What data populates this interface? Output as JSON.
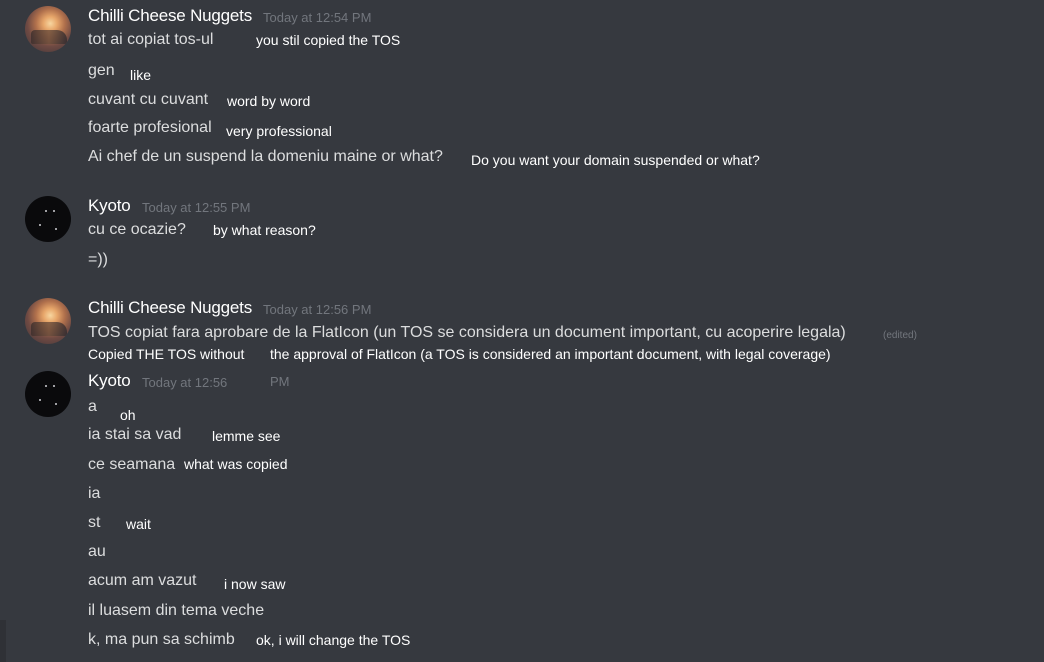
{
  "users": {
    "chilli": "Chilli Cheese Nuggets",
    "kyoto": "Kyoto"
  },
  "timestamps": {
    "t1": "Today at 12:54 PM",
    "t2": "Today at 12:55 PM",
    "t3": "Today at 12:56 PM",
    "t4a": "Today at 12:56",
    "t4b": "PM"
  },
  "group1": {
    "m1": "tot ai copiat tos-ul",
    "tr1": "you stil copied the TOS",
    "m2": "gen",
    "tr2": "like",
    "m3": "cuvant cu cuvant",
    "tr3": "word by word",
    "m4": "foarte profesional",
    "tr4": "very professional",
    "m5": "Ai chef de un suspend la domeniu maine or what?",
    "tr5": "Do you want your domain suspended or what?"
  },
  "group2": {
    "m1": "cu ce ocazie?",
    "tr1": "by what reason?",
    "m2": "=))"
  },
  "group3": {
    "m1": "TOS copiat fara aprobare de la FlatIcon (un TOS se considera un document important, cu acoperire legala)",
    "edited": "(edited)",
    "tr1a": "Copied THE TOS without",
    "tr1b": "the approval of FlatIcon (a TOS is considered an important document, with legal coverage)"
  },
  "group4": {
    "m1": "a",
    "tr1": "oh",
    "m2": "ia stai sa vad",
    "tr2": "lemme see",
    "m3": "ce seamana",
    "tr3": "what was copied",
    "m4": "ia",
    "m5": "st",
    "tr5": "wait",
    "m6": "au",
    "m7": "acum am vazut",
    "tr7": "i now saw",
    "m8": "il luasem din tema veche",
    "m9": "k, ma pun sa schimb",
    "tr9": "ok, i will change the TOS"
  }
}
